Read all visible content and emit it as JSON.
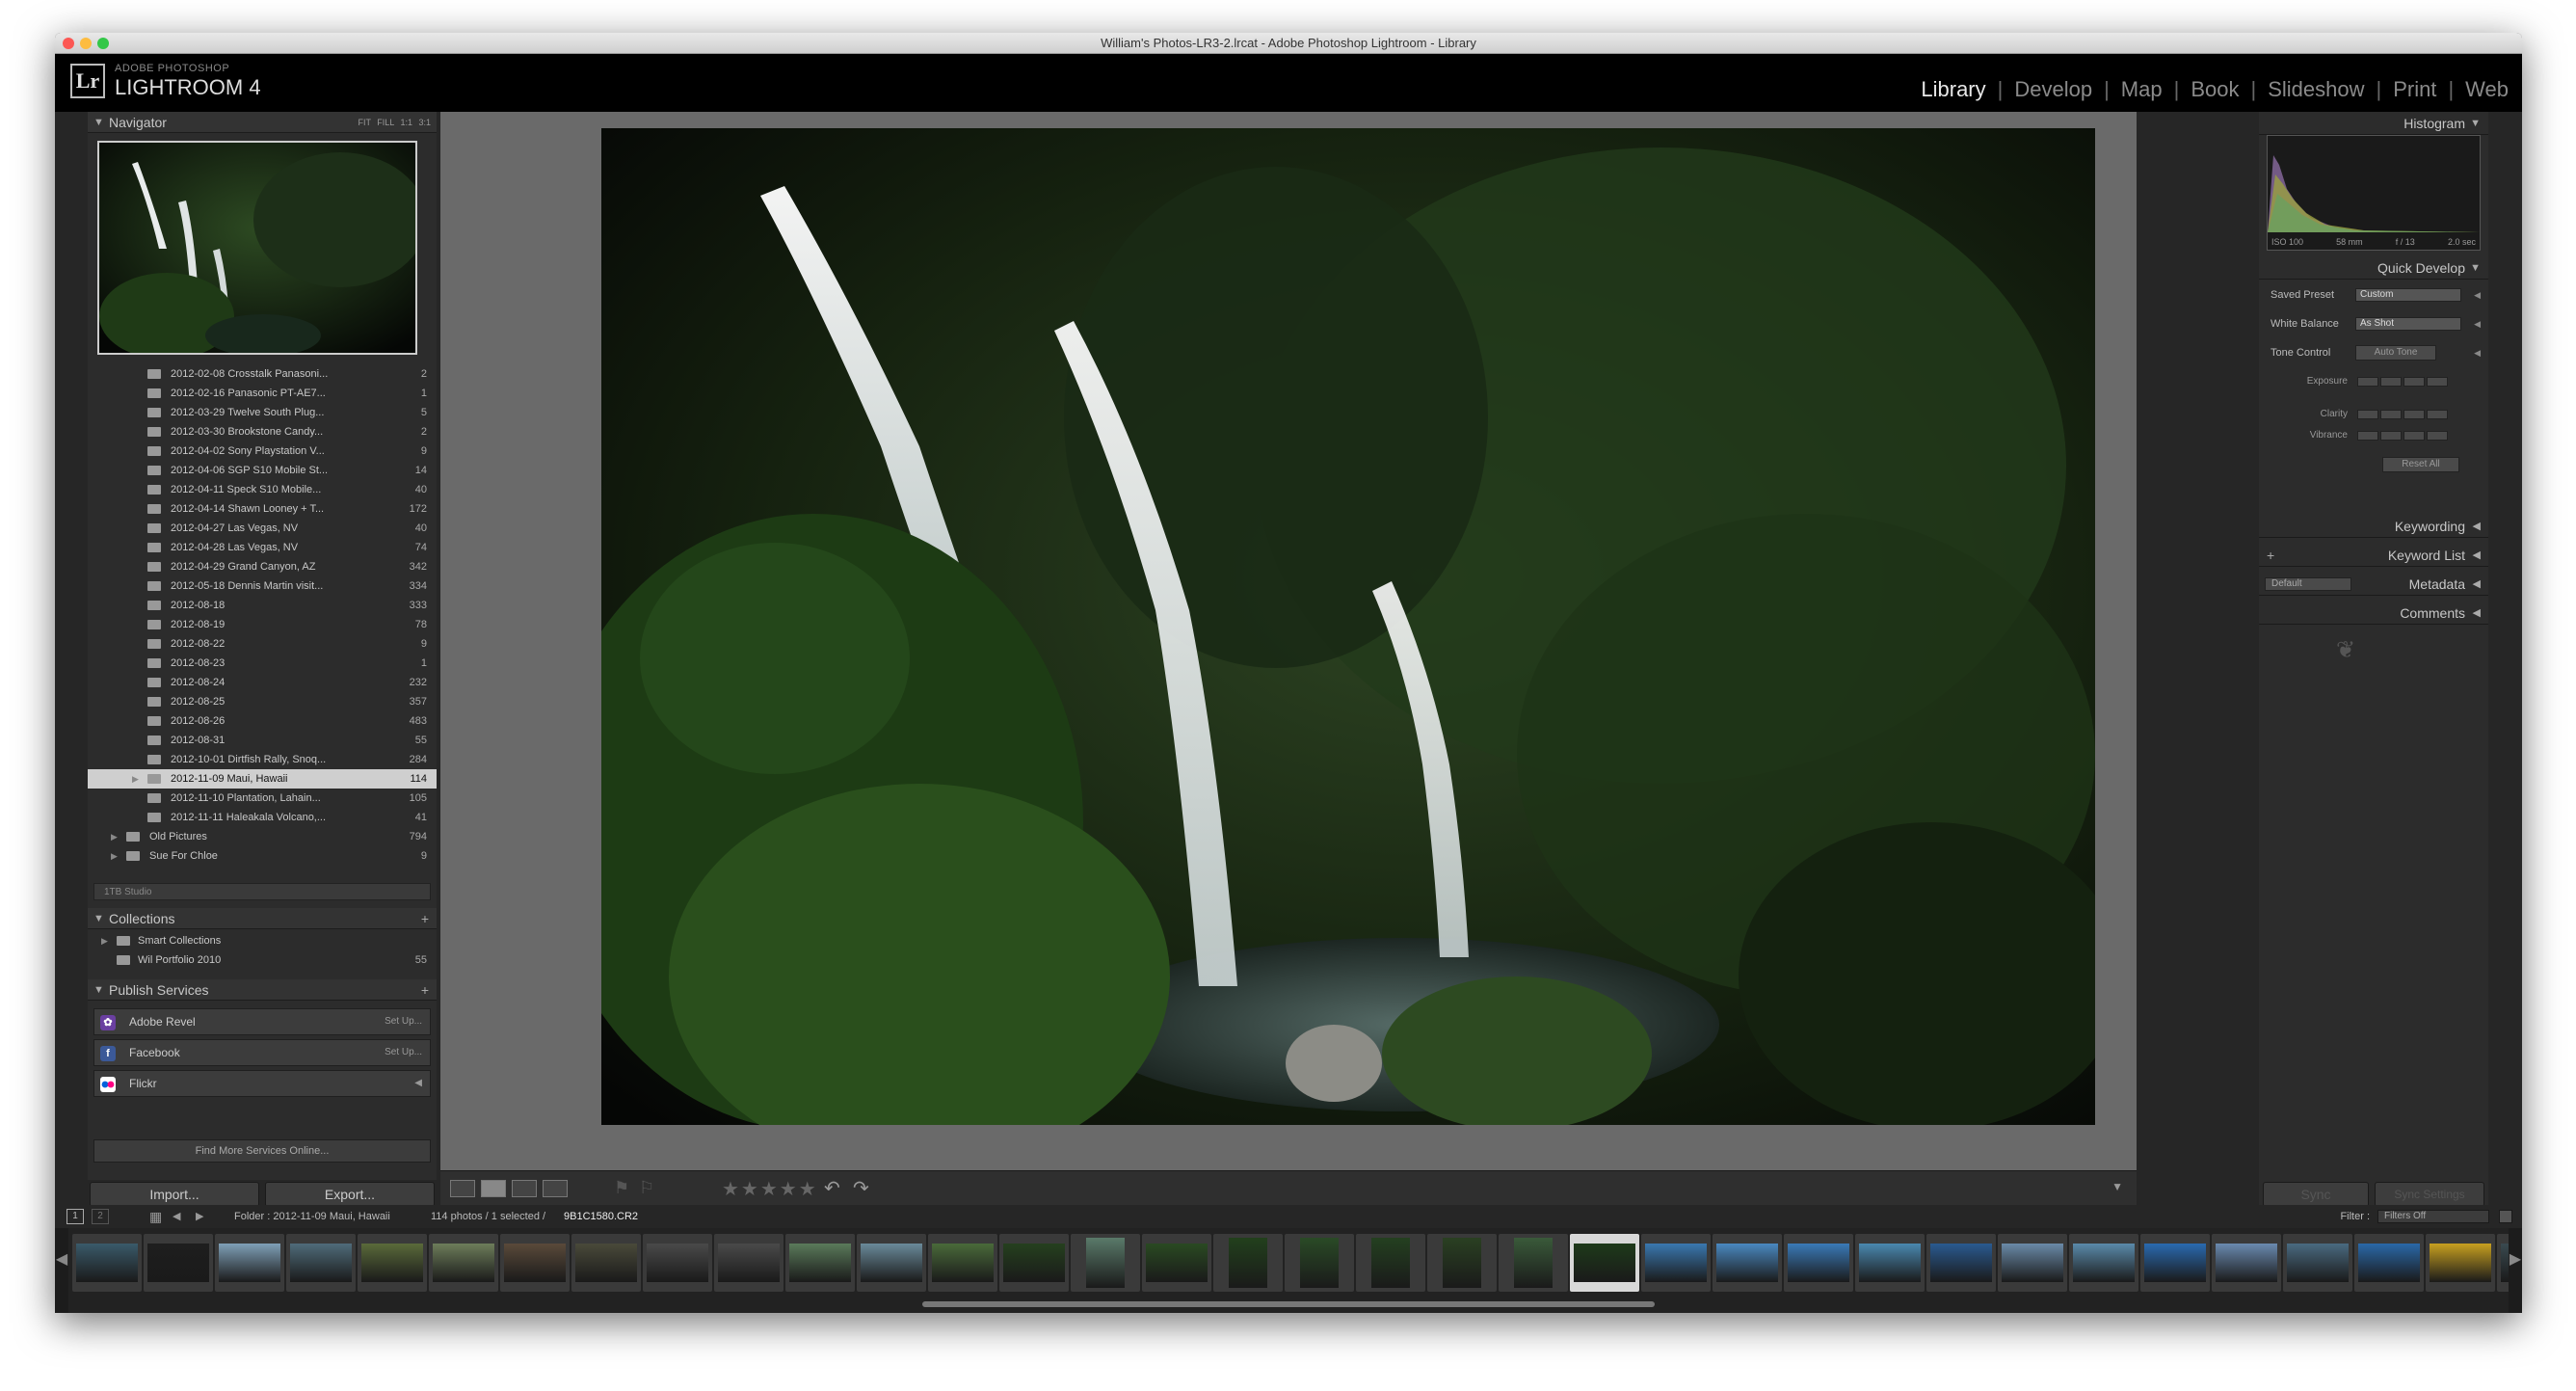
{
  "window": {
    "title": "William's Photos-LR3-2.lrcat - Adobe Photoshop Lightroom - Library"
  },
  "brand": {
    "line1": "ADOBE PHOTOSHOP",
    "line2": "LIGHTROOM 4",
    "logo": "Lr"
  },
  "modules": [
    {
      "label": "Library",
      "active": true
    },
    {
      "label": "Develop"
    },
    {
      "label": "Map"
    },
    {
      "label": "Book"
    },
    {
      "label": "Slideshow"
    },
    {
      "label": "Print"
    },
    {
      "label": "Web"
    }
  ],
  "navigator": {
    "title": "Navigator",
    "modes": "FIT FILL 1:1 3:1"
  },
  "folders": [
    {
      "name": "2012-02-08 Crosstalk Panasoni...",
      "count": "2"
    },
    {
      "name": "2012-02-16 Panasonic PT-AE7...",
      "count": "1"
    },
    {
      "name": "2012-03-29 Twelve South Plug...",
      "count": "5"
    },
    {
      "name": "2012-03-30 Brookstone Candy...",
      "count": "2"
    },
    {
      "name": "2012-04-02 Sony Playstation V...",
      "count": "9"
    },
    {
      "name": "2012-04-06 SGP S10 Mobile St...",
      "count": "14"
    },
    {
      "name": "2012-04-11 Speck S10 Mobile...",
      "count": "40"
    },
    {
      "name": "2012-04-14 Shawn Looney + T...",
      "count": "172"
    },
    {
      "name": "2012-04-27 Las Vegas, NV",
      "count": "40"
    },
    {
      "name": "2012-04-28 Las Vegas, NV",
      "count": "74"
    },
    {
      "name": "2012-04-29 Grand Canyon, AZ",
      "count": "342"
    },
    {
      "name": "2012-05-18 Dennis Martin visit...",
      "count": "334"
    },
    {
      "name": "2012-08-18",
      "count": "333"
    },
    {
      "name": "2012-08-19",
      "count": "78"
    },
    {
      "name": "2012-08-22",
      "count": "9"
    },
    {
      "name": "2012-08-23",
      "count": "1"
    },
    {
      "name": "2012-08-24",
      "count": "232"
    },
    {
      "name": "2012-08-25",
      "count": "357"
    },
    {
      "name": "2012-08-26",
      "count": "483"
    },
    {
      "name": "2012-08-31",
      "count": "55"
    },
    {
      "name": "2012-10-01 Dirtfish Rally, Snoq...",
      "count": "284"
    },
    {
      "name": "2012-11-09 Maui, Hawaii",
      "count": "114",
      "selected": true
    },
    {
      "name": "2012-11-10 Plantation, Lahain...",
      "count": "105"
    },
    {
      "name": "2012-11-11 Haleakala Volcano,...",
      "count": "41"
    },
    {
      "name": "Old Pictures",
      "count": "794",
      "parent": true
    },
    {
      "name": "Sue For Chloe",
      "count": "9",
      "parent": true
    }
  ],
  "volume": {
    "label": "1TB Studio"
  },
  "collections": {
    "title": "Collections",
    "items": [
      {
        "name": "Smart Collections",
        "count": ""
      },
      {
        "name": "Wil Portfolio 2010",
        "count": "55"
      }
    ]
  },
  "publish": {
    "title": "Publish Services",
    "services": [
      {
        "name": "Adobe Revel",
        "action": "Set Up...",
        "icon": "adobe-revel-icon",
        "color": "#6a3fa0"
      },
      {
        "name": "Facebook",
        "action": "Set Up...",
        "icon": "facebook-icon",
        "color": "#3b5998"
      },
      {
        "name": "Flickr",
        "action": "",
        "icon": "flickr-icon",
        "color": "#ffffff"
      }
    ],
    "find_more": "Find More Services Online..."
  },
  "buttons": {
    "import": "Import...",
    "export": "Export...",
    "sync": "Sync",
    "sync_settings": "Sync Settings"
  },
  "histogram": {
    "title": "Histogram",
    "iso": "ISO 100",
    "focal": "58 mm",
    "aperture": "f / 13",
    "shutter": "2.0 sec"
  },
  "quick_develop": {
    "title": "Quick Develop",
    "saved_preset_label": "Saved Preset",
    "saved_preset_value": "Custom",
    "white_balance_label": "White Balance",
    "white_balance_value": "As Shot",
    "tone_control_label": "Tone Control",
    "auto_tone": "Auto Tone",
    "exposure_label": "Exposure",
    "clarity_label": "Clarity",
    "vibrance_label": "Vibrance",
    "reset_all": "Reset All"
  },
  "right_panels": {
    "keywording": "Keywording",
    "keyword_list": "Keyword List",
    "metadata": "Metadata",
    "metadata_preset": "Default",
    "comments": "Comments"
  },
  "filmstrip": {
    "page1": "1",
    "page2": "2",
    "folder_label": "Folder : 2012-11-09 Maui, Hawaii",
    "count_label": "114 photos / 1 selected /",
    "filename": "9B1C1580.CR2",
    "filter_label": "Filter :",
    "filter_value": "Filters Off"
  },
  "colors": {
    "accent": "#e8e8e8",
    "panel": "#2c2c2c",
    "canvas": "#6a6a6a"
  }
}
